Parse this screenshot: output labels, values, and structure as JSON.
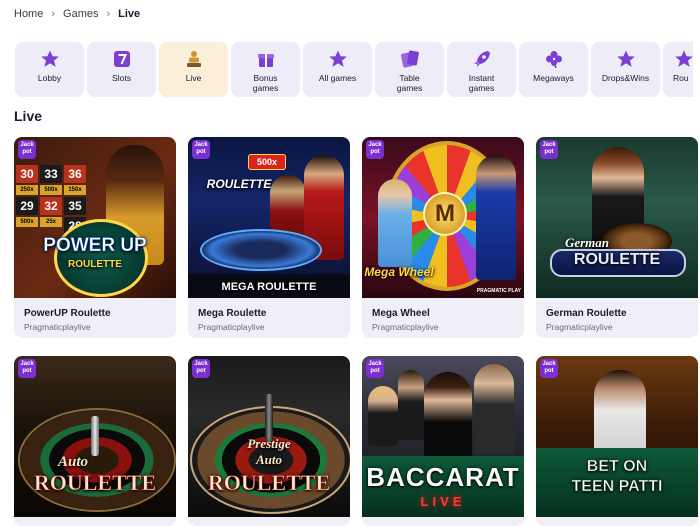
{
  "breadcrumb": {
    "home": "Home",
    "games": "Games",
    "current": "Live"
  },
  "categories": [
    {
      "label": "Lobby",
      "icon": "star-icon",
      "active": false
    },
    {
      "label": "Slots",
      "icon": "slot-seven-icon",
      "active": false
    },
    {
      "label": "Live",
      "icon": "dealer-icon",
      "active": true
    },
    {
      "label": "Bonus\ngames",
      "icon": "gift-icon",
      "active": false
    },
    {
      "label": "All games",
      "icon": "star-icon",
      "active": false
    },
    {
      "label": "Table\ngames",
      "icon": "cards-icon",
      "active": false
    },
    {
      "label": "Instant\ngames",
      "icon": "rocket-icon",
      "active": false
    },
    {
      "label": "Megaways",
      "icon": "clover-icon",
      "active": false
    },
    {
      "label": "Drops&Wins",
      "icon": "star-icon",
      "active": false
    },
    {
      "label": "Rou",
      "icon": "star-icon",
      "active": false
    }
  ],
  "section_title": "Live",
  "jackpot_badge": {
    "line1": "Jack",
    "line2": "pot"
  },
  "games": [
    {
      "name": "PowerUP Roulette",
      "provider": "Pragmaticplaylive",
      "art_title": "POWER UP",
      "art_sub": "ROULETTE",
      "numbers": [
        "30",
        "33",
        "36",
        "250x",
        "500x",
        "150x",
        "29",
        "32",
        "35",
        "500x",
        "25x",
        "28"
      ]
    },
    {
      "name": "Mega Roulette",
      "provider": "Pragmaticplaylive",
      "art_title": "MEGA ROULETTE",
      "art_badge": "500x",
      "art_top": "ROULETTE"
    },
    {
      "name": "Mega Wheel",
      "provider": "Pragmaticplaylive",
      "art_title": "Mega Wheel",
      "art_badge": "PRAGMATIC PLAY",
      "art_letter": "M"
    },
    {
      "name": "German Roulette",
      "provider": "Pragmaticplaylive",
      "art_title": "German",
      "art_sub": "ROULETTE"
    },
    {
      "art_title": "Auto",
      "art_sub": "ROULETTE"
    },
    {
      "art_title": "Prestige",
      "art_mid": "Auto",
      "art_sub": "ROULETTE"
    },
    {
      "art_title": "BACCARAT",
      "art_sub": "LIVE"
    },
    {
      "art_title": "BET ON",
      "art_sub": "TEEN PATTI"
    }
  ],
  "colors": {
    "jackpot": "#7c2fd0",
    "category_bg": "#eeecf6",
    "active_bg": "#fcefd9",
    "icon": "#7b3fd4"
  }
}
